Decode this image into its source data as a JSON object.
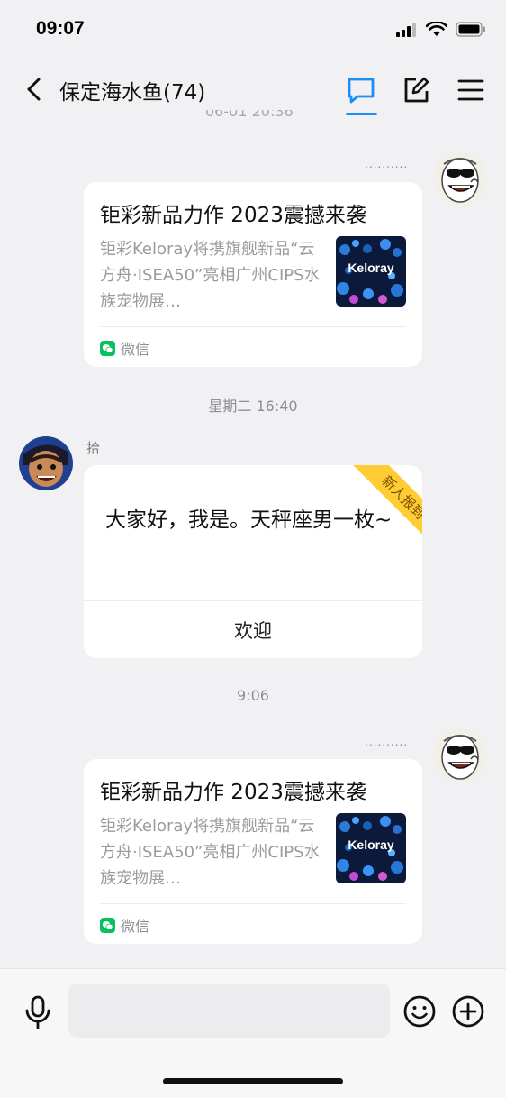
{
  "status_bar": {
    "time": "09:07",
    "icons": [
      "signal-icon",
      "wifi-icon",
      "battery-icon"
    ]
  },
  "header": {
    "title": "保定海水鱼(74)",
    "icons": [
      "back-icon",
      "chat-tab-icon",
      "edit-icon",
      "menu-icon"
    ],
    "accent_color": "#1d8ef6"
  },
  "messages": {
    "top_clipped_time": "06-01 20:36",
    "shared_article_1": {
      "dots": "..........",
      "title": "钜彩新品力作 2023震撼来袭",
      "description": "钜彩Keloray将携旗舰新品“云方舟·ISEA50”亮相广州CIPS水族宠物展…",
      "thumbnail_text": "Keloray",
      "source": "微信"
    },
    "time_2": "星期二 16:40",
    "intro_message": {
      "sender": "拾",
      "text": "大家好，我是。天秤座男一枚~",
      "ribbon": "新人报到",
      "button": "欢迎"
    },
    "time_3": "9:06",
    "shared_article_2": {
      "dots": "..........",
      "title": "钜彩新品力作 2023震撼来袭",
      "description": "钜彩Keloray将携旗舰新品“云方舟·ISEA50”亮相广州CIPS水族宠物展…",
      "thumbnail_text": "Keloray",
      "source": "微信"
    }
  },
  "input_bar": {
    "placeholder": "",
    "icons": [
      "microphone-icon",
      "emoji-icon",
      "plus-icon"
    ]
  }
}
